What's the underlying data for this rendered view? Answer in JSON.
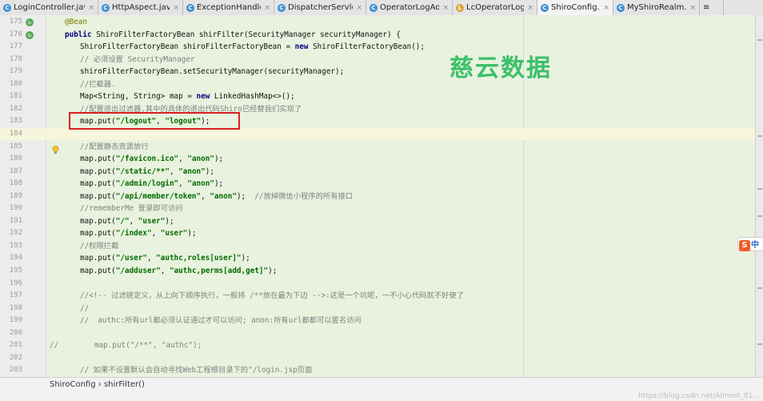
{
  "tabs": [
    {
      "label": "LoginController.java",
      "icon": "c",
      "active": false
    },
    {
      "label": "HttpAspect.java",
      "icon": "c",
      "active": false
    },
    {
      "label": "ExceptionHandle.java",
      "icon": "c",
      "active": false
    },
    {
      "label": "DispatcherServlet.class",
      "icon": "c",
      "active": false
    },
    {
      "label": "OperatorLogAop.java",
      "icon": "c",
      "active": false
    },
    {
      "label": "LcOperatorLog.java",
      "icon": "l",
      "active": false
    },
    {
      "label": "ShiroConfig.java",
      "icon": "c",
      "active": true
    },
    {
      "label": "MyShiroRealm.java",
      "icon": "c",
      "active": false
    }
  ],
  "tab_overflow": "≡",
  "lines": [
    {
      "n": "175",
      "segs": [
        [
          "ann",
          "@Bean"
        ]
      ],
      "indent": 1
    },
    {
      "n": "176",
      "segs": [
        [
          "kw",
          "public "
        ],
        [
          "",
          "ShiroFilterFactoryBean shirFilter(SecurityManager securityManager) {"
        ]
      ],
      "indent": 1
    },
    {
      "n": "177",
      "segs": [
        [
          "",
          "ShiroFilterFactoryBean shiroFilterFactoryBean = "
        ],
        [
          "kw",
          "new "
        ],
        [
          "",
          "ShiroFilterFactoryBean();"
        ]
      ],
      "indent": 2
    },
    {
      "n": "178",
      "segs": [
        [
          "cm",
          "// 必须设置 SecurityManager"
        ]
      ],
      "indent": 2
    },
    {
      "n": "179",
      "segs": [
        [
          "",
          "shiroFilterFactoryBean.setSecurityManager(securityManager);"
        ]
      ],
      "indent": 2
    },
    {
      "n": "180",
      "segs": [
        [
          "cm",
          "//拦截器."
        ]
      ],
      "indent": 2
    },
    {
      "n": "181",
      "segs": [
        [
          "",
          "Map<String, String> map = "
        ],
        [
          "kw",
          "new "
        ],
        [
          "",
          "LinkedHashMap<>();"
        ]
      ],
      "indent": 2
    },
    {
      "n": "182",
      "segs": [
        [
          "cm",
          "//配置退出过滤器,其中的具体的退出代码Shiro已经替我们实现了"
        ]
      ],
      "indent": 2
    },
    {
      "n": "183",
      "segs": [
        [
          "",
          "map.put("
        ],
        [
          "str",
          "\"/logout\""
        ],
        [
          "",
          ", "
        ],
        [
          "str",
          "\"logout\""
        ],
        [
          "",
          ");"
        ]
      ],
      "indent": 2
    },
    {
      "n": "184",
      "segs": [],
      "indent": 2
    },
    {
      "n": "185",
      "segs": [
        [
          "cm",
          "//配置静态资源放行"
        ]
      ],
      "indent": 2
    },
    {
      "n": "186",
      "segs": [
        [
          "",
          "map.put("
        ],
        [
          "str",
          "\"/favicon.ico\""
        ],
        [
          "",
          ", "
        ],
        [
          "str",
          "\"anon\""
        ],
        [
          "",
          ");"
        ]
      ],
      "indent": 2
    },
    {
      "n": "187",
      "segs": [
        [
          "",
          "map.put("
        ],
        [
          "str",
          "\"/static/**\""
        ],
        [
          "",
          ", "
        ],
        [
          "str",
          "\"anon\""
        ],
        [
          "",
          ");"
        ]
      ],
      "indent": 2
    },
    {
      "n": "188",
      "segs": [
        [
          "",
          "map.put("
        ],
        [
          "str",
          "\"/admin/login\""
        ],
        [
          "",
          ", "
        ],
        [
          "str",
          "\"anon\""
        ],
        [
          "",
          ");"
        ]
      ],
      "indent": 2
    },
    {
      "n": "189",
      "segs": [
        [
          "",
          "map.put("
        ],
        [
          "str",
          "\"/api/member/token\""
        ],
        [
          "",
          ", "
        ],
        [
          "str",
          "\"anon\""
        ],
        [
          "",
          ");  "
        ],
        [
          "cm",
          "//放掉微信小程序的所有接口"
        ]
      ],
      "indent": 2
    },
    {
      "n": "190",
      "segs": [
        [
          "cm",
          "//rememberMe 登录即可访问"
        ]
      ],
      "indent": 2
    },
    {
      "n": "191",
      "segs": [
        [
          "",
          "map.put("
        ],
        [
          "str",
          "\"/\""
        ],
        [
          "",
          ", "
        ],
        [
          "str",
          "\"user\""
        ],
        [
          "",
          ");"
        ]
      ],
      "indent": 2
    },
    {
      "n": "192",
      "segs": [
        [
          "",
          "map.put("
        ],
        [
          "str",
          "\"/index\""
        ],
        [
          "",
          ", "
        ],
        [
          "str",
          "\"user\""
        ],
        [
          "",
          ");"
        ]
      ],
      "indent": 2
    },
    {
      "n": "193",
      "segs": [
        [
          "cm",
          "//权限拦截"
        ]
      ],
      "indent": 2
    },
    {
      "n": "194",
      "segs": [
        [
          "",
          "map.put("
        ],
        [
          "str",
          "\"/user\""
        ],
        [
          "",
          ", "
        ],
        [
          "str",
          "\"authc,roles[user]\""
        ],
        [
          "",
          ");"
        ]
      ],
      "indent": 2
    },
    {
      "n": "195",
      "segs": [
        [
          "",
          "map.put("
        ],
        [
          "str",
          "\"/adduser\""
        ],
        [
          "",
          ", "
        ],
        [
          "str",
          "\"authc,perms[add,get]\""
        ],
        [
          "",
          ");"
        ]
      ],
      "indent": 2
    },
    {
      "n": "196",
      "segs": [],
      "indent": 2
    },
    {
      "n": "197",
      "segs": [
        [
          "cm",
          "//<!-- 过滤链定义，从上向下顺序执行，一般将 /**放在最为下边 -->:这是一个坑呢，一不小心代码就不好使了"
        ]
      ],
      "indent": 2
    },
    {
      "n": "198",
      "segs": [
        [
          "cm",
          "//"
        ]
      ],
      "indent": 2
    },
    {
      "n": "199",
      "segs": [
        [
          "cm",
          "//  authc:所有url都必须认证通过才可以访问; anon:所有url都都可以匿名访问"
        ]
      ],
      "indent": 2
    },
    {
      "n": "200",
      "segs": [],
      "indent": 2
    },
    {
      "n": "201",
      "segs": [
        [
          "cm",
          "//        map.put(\"/**\", \"authc\");"
        ]
      ],
      "indent": 0
    },
    {
      "n": "202",
      "segs": [],
      "indent": 2
    },
    {
      "n": "203",
      "segs": [
        [
          "cm",
          "// 如果不设置默认会自动寻找Web工程根目录下的\"/login.jsp页面"
        ]
      ],
      "indent": 2
    }
  ],
  "watermark": "慈云数据",
  "status_bar": {
    "class": "ShiroConfig",
    "separator": "›",
    "method": "shirFilter()"
  },
  "ime": {
    "s": "S",
    "z": "中"
  },
  "url": "https://blog.csdn.net/Almost_81..."
}
